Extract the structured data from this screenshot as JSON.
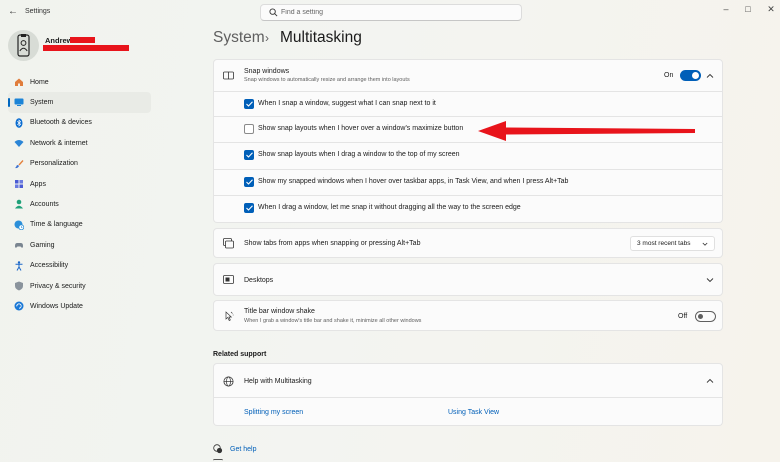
{
  "window": {
    "title": "Settings",
    "back_icon": "back-arrow-icon"
  },
  "search": {
    "placeholder": "Find a setting"
  },
  "user": {
    "name": "Andrew"
  },
  "nav": {
    "items": [
      {
        "label": "Home",
        "icon": "home-icon"
      },
      {
        "label": "System",
        "icon": "system-icon",
        "active": true
      },
      {
        "label": "Bluetooth & devices",
        "icon": "bluetooth-icon"
      },
      {
        "label": "Network & internet",
        "icon": "wifi-icon"
      },
      {
        "label": "Personalization",
        "icon": "brush-icon"
      },
      {
        "label": "Apps",
        "icon": "apps-icon"
      },
      {
        "label": "Accounts",
        "icon": "accounts-icon"
      },
      {
        "label": "Time & language",
        "icon": "globe-clock-icon"
      },
      {
        "label": "Gaming",
        "icon": "gamepad-icon"
      },
      {
        "label": "Accessibility",
        "icon": "accessibility-icon"
      },
      {
        "label": "Privacy & security",
        "icon": "shield-icon"
      },
      {
        "label": "Windows Update",
        "icon": "update-icon"
      }
    ]
  },
  "breadcrumb": {
    "parent": "System",
    "separator": "›",
    "current": "Multitasking"
  },
  "snap": {
    "title": "Snap windows",
    "subtitle": "Snap windows to automatically resize and arrange them into layouts",
    "state_label": "On",
    "options": [
      {
        "label": "When I snap a window, suggest what I can snap next to it",
        "checked": true
      },
      {
        "label": "Show snap layouts when I hover over a window's maximize button",
        "checked": false
      },
      {
        "label": "Show snap layouts when I drag a window to the top of my screen",
        "checked": true
      },
      {
        "label": "Show my snapped windows when I hover over taskbar apps, in Task View, and when I press Alt+Tab",
        "checked": true
      },
      {
        "label": "When I drag a window, let me snap it without dragging all the way to the screen edge",
        "checked": true
      }
    ]
  },
  "tabs_setting": {
    "title": "Show tabs from apps when snapping or pressing Alt+Tab",
    "value": "3 most recent tabs"
  },
  "desktops": {
    "title": "Desktops"
  },
  "shake": {
    "title": "Title bar window shake",
    "subtitle": "When I grab a window's title bar and shake it, minimize all other windows",
    "state_label": "Off"
  },
  "related": {
    "heading": "Related support",
    "help_title": "Help with Multitasking",
    "links": [
      "Splitting my screen",
      "Using Task View"
    ]
  },
  "footer": {
    "get_help": "Get help"
  },
  "colors": {
    "accent": "#005fb8",
    "annotation_arrow": "#e8141b"
  }
}
